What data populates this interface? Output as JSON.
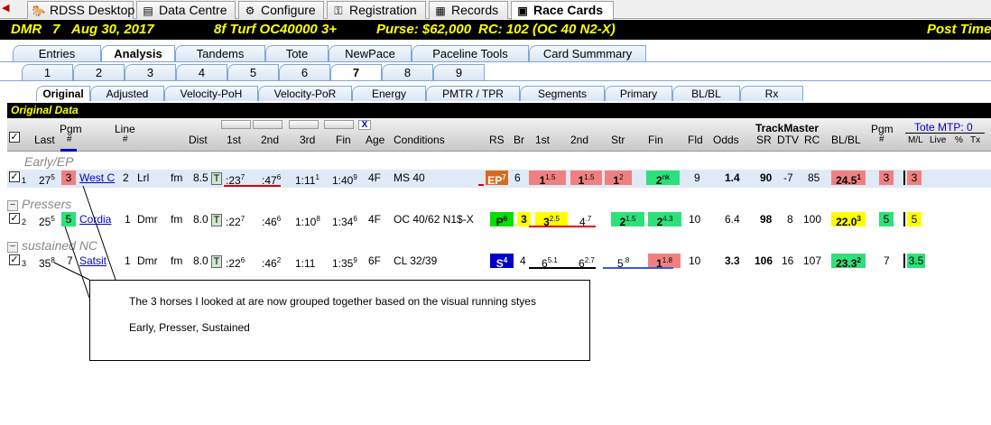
{
  "top_tabs": [
    {
      "label": "RDSS Desktop",
      "icon": "horse-icon"
    },
    {
      "label": "Data Centre",
      "icon": "database-icon"
    },
    {
      "label": "Configure",
      "icon": "gear-icon"
    },
    {
      "label": "Registration",
      "icon": "key-icon"
    },
    {
      "label": "Records",
      "icon": "grid-icon"
    },
    {
      "label": "Race Cards",
      "icon": "card-icon",
      "active": true
    }
  ],
  "race_header": {
    "track": "DMR",
    "race": "7",
    "date": "Aug 30, 2017",
    "conditions": "8f  Turf  OC40000  3+",
    "purse": "Purse: $62,000",
    "rc": "RC: 102  (OC 40 N2-X)",
    "post": "Post Time"
  },
  "func_tabs": [
    "Entries",
    "Analysis",
    "Tandems",
    "Tote",
    "NewPace",
    "Paceline Tools",
    "Card Summmary"
  ],
  "race_tabs": [
    "1",
    "2",
    "3",
    "4",
    "5",
    "6",
    "7",
    "8",
    "9"
  ],
  "view_tabs": [
    "Original",
    "Adjusted",
    "Velocity-PoH",
    "Velocity-PoR",
    "Energy",
    "PMTR / TPR",
    "Segments",
    "Primary",
    "BL/BL",
    "Rx"
  ],
  "section_title": "Original Data",
  "columns": {
    "last": "Last",
    "pgm": "Pgm",
    "pgm2": "#",
    "line": "Line",
    "line2": "#",
    "dist": "Dist",
    "c1": "1st",
    "c2": "2nd",
    "c3": "3rd",
    "fin": "Fin",
    "age": "Age",
    "cond": "Conditions",
    "rs": "RS",
    "br": "Br",
    "p1": "1st",
    "p2": "2nd",
    "str": "Str",
    "pfin": "Fin",
    "fld": "Fld",
    "odds": "Odds",
    "trackmaster": "TrackMaster",
    "sr": "SR",
    "dtv": "DTV",
    "rc": "RC",
    "blbl": "BL/BL",
    "pgm_b": "Pgm",
    "pgm_b2": "#",
    "tote": "Tote MTP:  0",
    "ml": "M/L",
    "live": "Live",
    "pct": "%",
    "tx": "Tx",
    "x": "X"
  },
  "groups": [
    {
      "label": "Early/EP"
    },
    {
      "label": "Pressers"
    },
    {
      "label": "sustained NC"
    }
  ],
  "rows": [
    {
      "idx": "1",
      "last": "27",
      "last_sup": "5",
      "pgm": "3",
      "name": "West C",
      "line": "2",
      "track": "Lrl",
      "surf": "fm",
      "dist": "8.5",
      "t": "T",
      "f1": ":23",
      "f1s": "7",
      "f2": ":47",
      "f2s": "6",
      "f3": "1:11",
      "f3s": "1",
      "fin": "1:40",
      "fins": "9",
      "age": "4F",
      "cond": "MS 40",
      "rs": "EP",
      "rss": "7",
      "br": "6",
      "p1": "1",
      "p1s": "1.5",
      "p2": "1",
      "p2s": "1.5",
      "pstr": "1",
      "pstrs": "2",
      "pfin": "2",
      "pfins": "nk",
      "fld": "9",
      "odds": "1.4",
      "sr": "90",
      "dtv": "-7",
      "rc": "85",
      "blbl": "24.5",
      "blbls": "1",
      "pgm_b": "3",
      "ml": "3"
    },
    {
      "idx": "2",
      "last": "25",
      "last_sup": "5",
      "pgm": "5",
      "name": "Cordia",
      "line": "1",
      "track": "Dmr",
      "surf": "fm",
      "dist": "8.0",
      "t": "T",
      "f1": ":22",
      "f1s": "7",
      "f2": ":46",
      "f2s": "6",
      "f3": "1:10",
      "f3s": "8",
      "fin": "1:34",
      "fins": "6",
      "age": "4F",
      "cond": "OC 40/62 N1$-X",
      "rs": "P",
      "rss": "6",
      "br": "3",
      "p1": "3",
      "p1s": "2.5",
      "p2": "4",
      "p2s": ".7",
      "pstr": "2",
      "pstrs": "1.5",
      "pfin": "2",
      "pfins": "4.3",
      "fld": "10",
      "odds": "6.4",
      "sr": "98",
      "dtv": "8",
      "rc": "100",
      "blbl": "22.0",
      "blbls": "3",
      "pgm_b": "5",
      "ml": "5"
    },
    {
      "idx": "3",
      "last": "35",
      "last_sup": "8",
      "pgm": "7",
      "name": "Satsit",
      "line": "1",
      "track": "Dmr",
      "surf": "fm",
      "dist": "8.0",
      "t": "T",
      "f1": ":22",
      "f1s": "6",
      "f2": ":46",
      "f2s": "2",
      "f3": "1:11",
      "f3s": "",
      "fin": "1:35",
      "fins": "9",
      "age": "6F",
      "cond": "CL 32/39",
      "rs": "S",
      "rss": "4",
      "br": "4",
      "p1": "6",
      "p1s": "5.1",
      "p2": "6",
      "p2s": "2.7",
      "pstr": "5",
      "pstrs": ".8",
      "pfin": "1",
      "pfins": "1.8",
      "fld": "10",
      "odds": "3.3",
      "sr": "106",
      "dtv": "16",
      "rc": "107",
      "blbl": "23.3",
      "blbls": "2",
      "pgm_b": "7",
      "ml": "3.5"
    }
  ],
  "annotation": {
    "line1": "The 3  horses I looked at  are now grouped together based on the visual running styes",
    "line2": "Early, Presser, Sustained"
  },
  "colors": {
    "header_bg": "#000000",
    "header_text": "#ffff00",
    "pink": "#f08080",
    "green": "#2ee07a",
    "yellow": "#ffff00",
    "blue": "#0000cc",
    "orange": "#d86a1e",
    "underline_red": "#e00000",
    "underline_blue": "#3a5bd8"
  }
}
